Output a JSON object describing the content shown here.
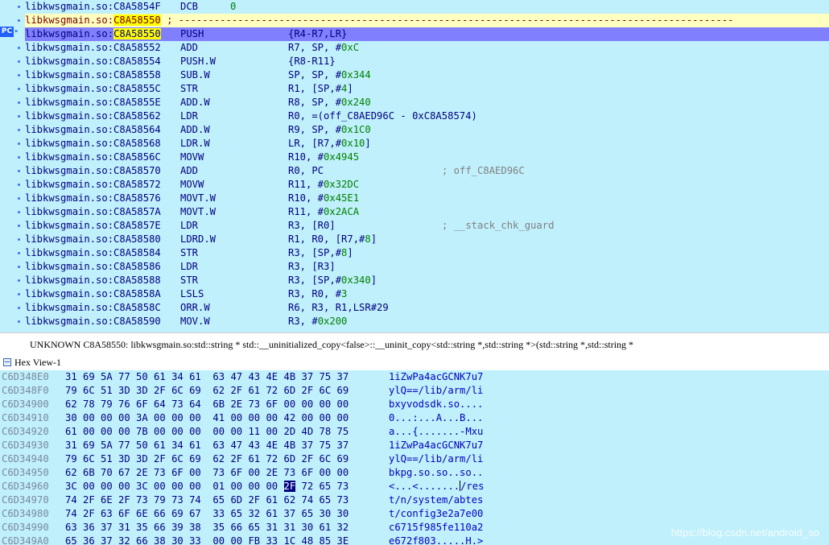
{
  "disasm": {
    "lines": [
      {
        "addr": "libkwsgmain.so:C8A5854F",
        "mn": "DCB",
        "op": "0",
        "kind": "data"
      },
      {
        "addr": "libkwsgmain.so:",
        "addr_hl": "C8A58550",
        "mn": " ; ----------------------------------------------------------------------------------------------",
        "kind": "sep"
      },
      {
        "addr": "libkwsgmain.so:",
        "addr_hl": "C8A58550",
        "mn": "PUSH",
        "op": "{R4-R7,LR}",
        "kind": "cur"
      },
      {
        "addr": "libkwsgmain.so:C8A58552",
        "mn": "ADD",
        "op": "R7, SP, #",
        "opnum": "0xC"
      },
      {
        "addr": "libkwsgmain.so:C8A58554",
        "mn": "PUSH.W",
        "op": "{R8-R11}"
      },
      {
        "addr": "libkwsgmain.so:C8A58558",
        "mn": "SUB.W",
        "op": "SP, SP, #",
        "opnum": "0x344"
      },
      {
        "addr": "libkwsgmain.so:C8A5855C",
        "mn": "STR",
        "op": "R1, [SP,#",
        "opnum": "4",
        "opend": "]"
      },
      {
        "addr": "libkwsgmain.so:C8A5855E",
        "mn": "ADD.W",
        "op": "R8, SP, #",
        "opnum": "0x240"
      },
      {
        "addr": "libkwsgmain.so:C8A58562",
        "mn": "LDR",
        "op": "R0, =(off_C8AED96C - 0xC8A58574)"
      },
      {
        "addr": "libkwsgmain.so:C8A58564",
        "mn": "ADD.W",
        "op": "R9, SP, #",
        "opnum": "0x1C0"
      },
      {
        "addr": "libkwsgmain.so:C8A58568",
        "mn": "LDR.W",
        "op": "LR, [R7,#",
        "opnum": "0x10",
        "opend": "]"
      },
      {
        "addr": "libkwsgmain.so:C8A5856C",
        "mn": "MOVW",
        "op": "R10, #",
        "opnum": "0x4945"
      },
      {
        "addr": "libkwsgmain.so:C8A58570",
        "mn": "ADD",
        "op": "R0, PC",
        "cmt": "; off_C8AED96C"
      },
      {
        "addr": "libkwsgmain.so:C8A58572",
        "mn": "MOVW",
        "op": "R11, #",
        "opnum": "0x32DC"
      },
      {
        "addr": "libkwsgmain.so:C8A58576",
        "mn": "MOVT.W",
        "op": "R10, #",
        "opnum": "0x45E1"
      },
      {
        "addr": "libkwsgmain.so:C8A5857A",
        "mn": "MOVT.W",
        "op": "R11, #",
        "opnum": "0x2ACA"
      },
      {
        "addr": "libkwsgmain.so:C8A5857E",
        "mn": "LDR",
        "op": "R3, [R0]",
        "cmt": "; __stack_chk_guard"
      },
      {
        "addr": "libkwsgmain.so:C8A58580",
        "mn": "LDRD.W",
        "op": "R1, R0, [R7,#",
        "opnum": "8",
        "opend": "]"
      },
      {
        "addr": "libkwsgmain.so:C8A58584",
        "mn": "STR",
        "op": "R3, [SP,#",
        "opnum": "8",
        "opend": "]"
      },
      {
        "addr": "libkwsgmain.so:C8A58586",
        "mn": "LDR",
        "op": "R3, [R3]"
      },
      {
        "addr": "libkwsgmain.so:C8A58588",
        "mn": "STR",
        "op": "R3, [SP,#",
        "opnum": "0x340",
        "opend": "]"
      },
      {
        "addr": "libkwsgmain.so:C8A5858A",
        "mn": "LSLS",
        "op": "R3, R0, #",
        "opnum": "3"
      },
      {
        "addr": "libkwsgmain.so:C8A5858C",
        "mn": "ORR.W",
        "op": "R6, R3, R1,LSR#29"
      },
      {
        "addr": "libkwsgmain.so:C8A58590",
        "mn": "MOV.W",
        "op": "R3, #",
        "opnum": "0x200"
      }
    ],
    "pc_label": "PC"
  },
  "status": "UNKNOWN C8A58550: libkwsgmain.so:std::string * std::__uninitialized_copy<false>::__uninit_copy<std::string *,std::string *>(std::string *,std::string *",
  "hex": {
    "tab_label": "Hex View-1",
    "rows": [
      {
        "addr": "C6D348E0",
        "bytes": "31 69 5A 77 50 61 34 61  63 47 43 4E 4B 37 75 37",
        "ascii": "1iZwPa4acGCNK7u7"
      },
      {
        "addr": "C6D348F0",
        "bytes": "79 6C 51 3D 3D 2F 6C 69  62 2F 61 72 6D 2F 6C 69",
        "ascii": "ylQ==/lib/arm/li"
      },
      {
        "addr": "C6D34900",
        "bytes": "62 78 79 76 6F 64 73 64  6B 2E 73 6F 00 00 00 00",
        "ascii": "bxyvodsdk.so...."
      },
      {
        "addr": "C6D34910",
        "bytes": "30 00 00 00 3A 00 00 00  41 00 00 00 42 00 00 00",
        "ascii": "0...:...A...B..."
      },
      {
        "addr": "C6D34920",
        "bytes": "61 00 00 00 7B 00 00 00  00 00 11 00 2D 4D 78 75",
        "ascii": "a...{.......-Mxu"
      },
      {
        "addr": "C6D34930",
        "bytes": "31 69 5A 77 50 61 34 61  63 47 43 4E 4B 37 75 37",
        "ascii": "1iZwPa4acGCNK7u7"
      },
      {
        "addr": "C6D34940",
        "bytes": "79 6C 51 3D 3D 2F 6C 69  62 2F 61 72 6D 2F 6C 69",
        "ascii": "ylQ==/lib/arm/li"
      },
      {
        "addr": "C6D34950",
        "bytes": "62 6B 70 67 2E 73 6F 00  73 6F 00 2E 73 6F 00 00",
        "ascii": "bkpg.so.so..so.."
      },
      {
        "addr": "C6D34960",
        "bytes_pre": "3C 00 00 00 3C 00 00 00  01 00 00 00 ",
        "bytes_sel": "2F",
        "bytes_post": " 72 65 73",
        "ascii_pre": "<...<.......",
        "ascii_post": "/res",
        "selected": true
      },
      {
        "addr": "C6D34970",
        "bytes": "74 2F 6E 2F 73 79 73 74  65 6D 2F 61 62 74 65 73",
        "ascii": "t/n/system/abtes"
      },
      {
        "addr": "C6D34980",
        "bytes": "74 2F 63 6F 6E 66 69 67  33 65 32 61 37 65 30 30",
        "ascii": "t/config3e2a7e00"
      },
      {
        "addr": "C6D34990",
        "bytes": "63 36 37 31 35 66 39 38  35 66 65 31 31 30 61 32",
        "ascii": "c6715f985fe110a2"
      },
      {
        "addr": "C6D349A0",
        "bytes": "65 36 37 32 66 38 30 33  00 00 FB 33 1C 48 85 3E",
        "ascii": "e672f803.....H.>"
      }
    ]
  },
  "watermark": "https://blog.csdn.net/android_so"
}
